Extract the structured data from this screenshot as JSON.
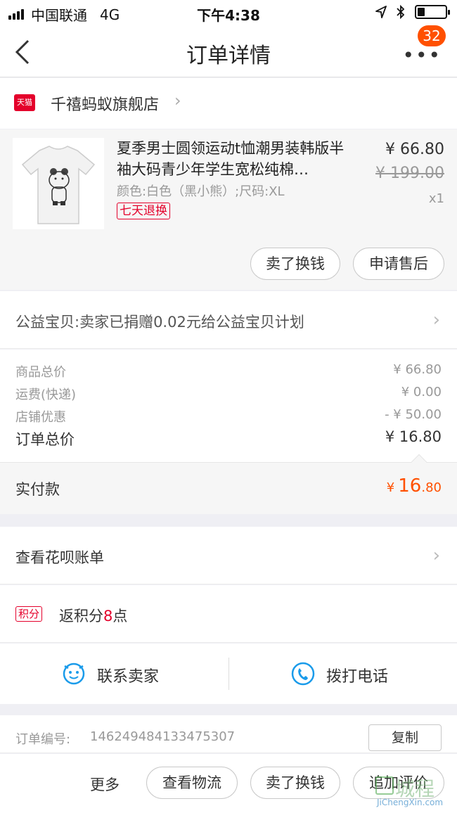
{
  "status_bar": {
    "carrier": "中国联通",
    "network": "4G",
    "time": "下午4:38",
    "icons": [
      "location-arrow-icon",
      "bluetooth-icon",
      "battery-icon"
    ]
  },
  "navbar": {
    "title": "订单详情",
    "more_label": "•••",
    "badge_count": "32",
    "back_icon": "chevron-left-icon"
  },
  "shop": {
    "platform_label": "天猫",
    "name": "千禧蚂蚁旗舰店"
  },
  "product": {
    "title": "夏季男士圆领运动t恤潮男装韩版半袖大码青少年学生宽松纯棉…",
    "sku": "颜色:白色（黑小熊）;尺码:XL",
    "return_tag": "七天退换",
    "price": "¥ 66.80",
    "original_price": "¥ 199.00",
    "quantity": "x1",
    "buttons": {
      "sell": "卖了换钱",
      "after_sale": "申请售后"
    }
  },
  "charity": {
    "text": "公益宝贝:卖家已捐赠0.02元给公益宝贝计划"
  },
  "summary": {
    "rows": [
      {
        "label": "商品总价",
        "value": "¥ 66.80"
      },
      {
        "label": "运费(快递)",
        "value": "¥ 0.00"
      },
      {
        "label": "店铺优惠",
        "value": "- ¥ 50.00"
      },
      {
        "label": "订单总价",
        "value": "¥ 16.80"
      }
    ]
  },
  "paid": {
    "label": "实付款",
    "currency": "¥",
    "integer": "16",
    "decimal": ".80"
  },
  "huabei": {
    "text": "查看花呗账单"
  },
  "points": {
    "tag": "积分",
    "prefix": "返积分",
    "number": "8",
    "suffix": "点"
  },
  "contact": {
    "seller": "联系卖家",
    "phone": "拨打电话"
  },
  "order": {
    "label": "订单编号:",
    "number": "146249484133475307",
    "copy": "复制"
  },
  "bottom_bar": {
    "more": "更多",
    "logistics": "查看物流",
    "sell": "卖了换钱",
    "review": "追加评价"
  },
  "watermark": {
    "text": "城程",
    "sub": "JiChengXin.com"
  },
  "colors": {
    "accent": "#ff5000",
    "tmall_red": "#e4002b",
    "icon_blue": "#1a9bea"
  }
}
